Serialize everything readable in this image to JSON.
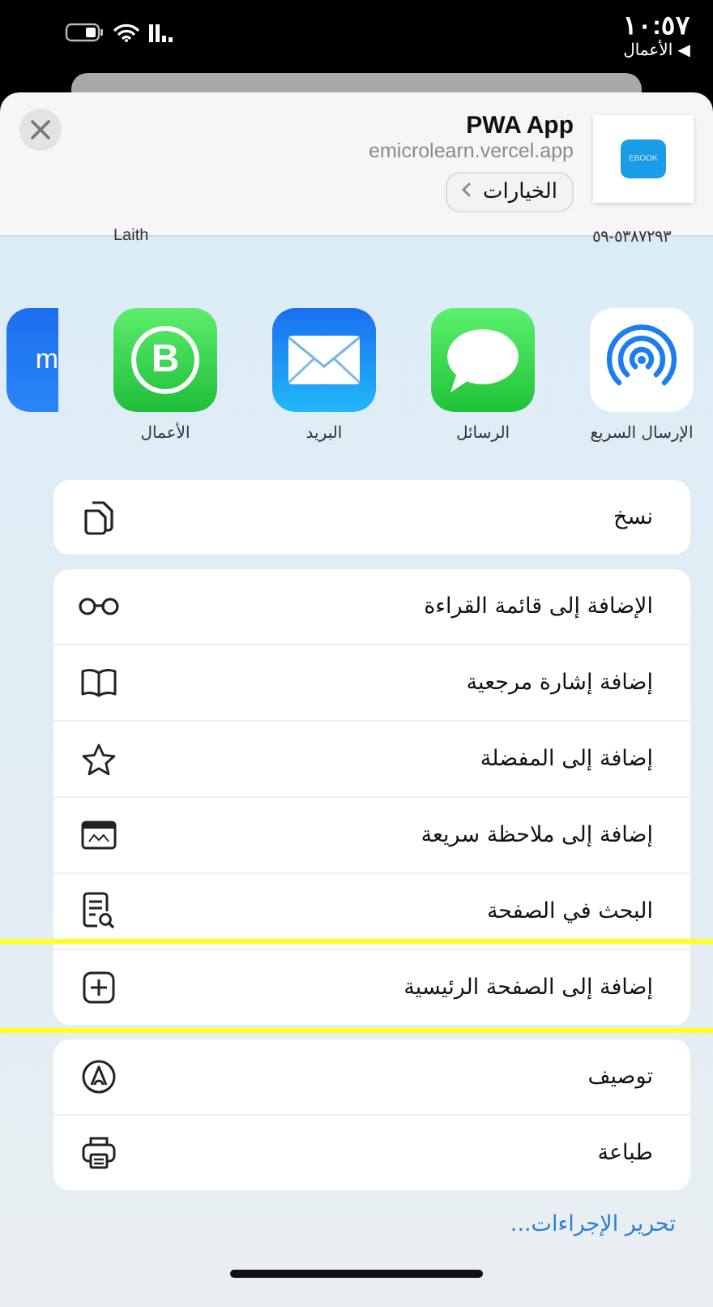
{
  "status_bar": {
    "time": "١٠:٥٧",
    "back_label": "◀ الأعمال"
  },
  "share_header": {
    "title": "PWA App",
    "url": "emicrolearn.vercel.app",
    "options_button": "الخيارات",
    "app_icon_text": "EBOOK"
  },
  "contacts": [
    {
      "label": "٥٣٨٧٢٩٣-٥٩"
    },
    {
      "label": "Laith"
    }
  ],
  "apps": [
    {
      "kind": "airdrop",
      "label": "الإرسال السريع"
    },
    {
      "kind": "messages",
      "label": "الرسائل"
    },
    {
      "kind": "mail",
      "label": "البريد"
    },
    {
      "kind": "whatsapp",
      "label": "الأعمال",
      "glyph": "B"
    },
    {
      "kind": "partial",
      "glyph": "m"
    }
  ],
  "action_groups": [
    {
      "items": [
        {
          "label": "نسخ",
          "highlighted": false
        }
      ]
    },
    {
      "items": [
        {
          "label": "الإضافة إلى قائمة القراءة",
          "highlighted": false
        },
        {
          "label": "إضافة إشارة مرجعية",
          "highlighted": false
        },
        {
          "label": "إضافة إلى المفضلة",
          "highlighted": false
        },
        {
          "label": "إضافة إلى ملاحظة سريعة",
          "highlighted": false
        },
        {
          "label": "البحث في الصفحة",
          "highlighted": false
        },
        {
          "label": "إضافة إلى الصفحة الرئيسية",
          "highlighted": true
        }
      ]
    },
    {
      "items": [
        {
          "label": "توصيف",
          "highlighted": false
        },
        {
          "label": "طباعة",
          "highlighted": false
        }
      ]
    }
  ],
  "edit_actions_link": "تحرير الإجراءات..."
}
